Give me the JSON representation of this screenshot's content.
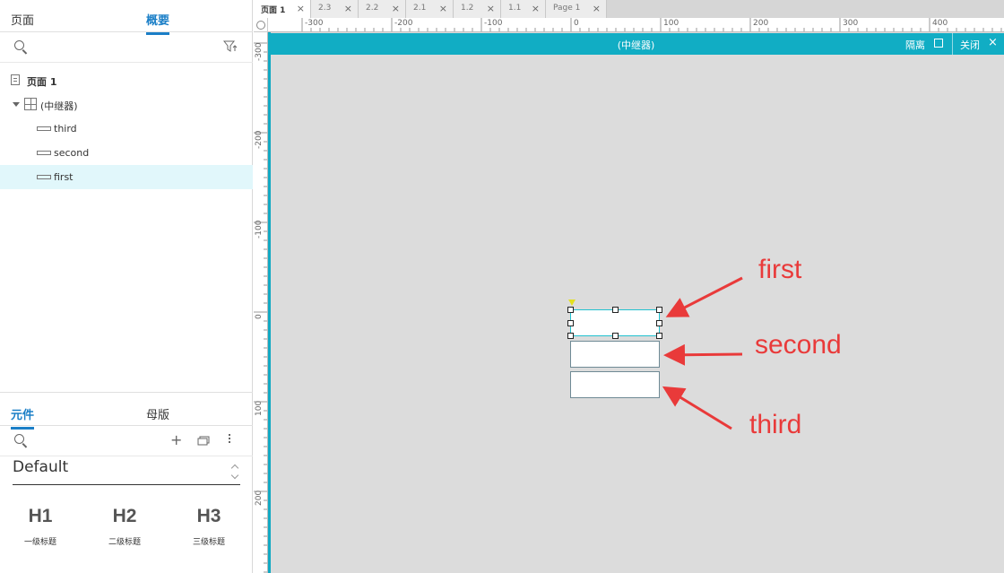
{
  "left_panel": {
    "top_tabs": {
      "pages": "页面",
      "outline": "概要"
    },
    "tree": {
      "page": "页面 1",
      "repeater": "(中继器)",
      "items": [
        "third",
        "second",
        "first"
      ]
    },
    "bottom_tabs": {
      "library": "元件",
      "masters": "母版"
    },
    "library_name": "Default",
    "widgets": [
      {
        "glyph": "H1",
        "caption": "一级标题"
      },
      {
        "glyph": "H2",
        "caption": "二级标题"
      },
      {
        "glyph": "H3",
        "caption": "三级标题"
      }
    ]
  },
  "doc_tabs": [
    "页面 1",
    "2.3",
    "2.2",
    "2.1",
    "1.2",
    "1.1",
    "Page 1"
  ],
  "ruler": {
    "horizontal": [
      "-300",
      "-200",
      "-100",
      "0",
      "100",
      "200",
      "300",
      "400"
    ],
    "vertical": [
      "-300",
      "-200",
      "-100",
      "0",
      "100",
      "200"
    ]
  },
  "canvas_bar": {
    "title": "(中继器)",
    "isolate": "隔离",
    "close": "关闭"
  },
  "annotations": {
    "first": "first",
    "second": "second",
    "third": "third"
  },
  "colors": {
    "accent": "#11adc4",
    "annotation": "#e93a3a",
    "selection": "#e1f7fb"
  }
}
